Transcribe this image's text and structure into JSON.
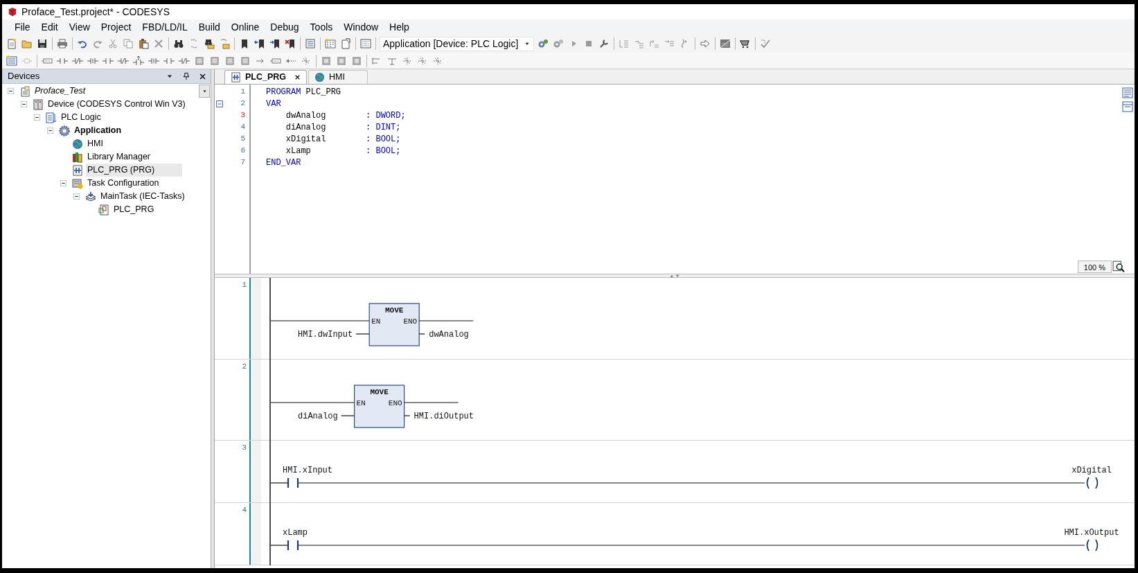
{
  "window": {
    "title": "Proface_Test.project* - CODESYS"
  },
  "menu": [
    "File",
    "Edit",
    "View",
    "Project",
    "FBD/LD/IL",
    "Build",
    "Online",
    "Debug",
    "Tools",
    "Window",
    "Help"
  ],
  "toolbar": {
    "application_selector": "Application [Device: PLC Logic]"
  },
  "devices_panel": {
    "title": "Devices",
    "tree": [
      {
        "label": "Proface_Test",
        "kind": "project",
        "expanded": true,
        "selected": false,
        "children": [
          {
            "label": "Device (CODESYS Control Win V3)",
            "kind": "device",
            "expanded": true,
            "selected": false,
            "children": [
              {
                "label": "PLC Logic",
                "kind": "plc",
                "expanded": true,
                "selected": false,
                "children": [
                  {
                    "label": "Application",
                    "kind": "application",
                    "expanded": true,
                    "selected": false,
                    "children": [
                      {
                        "label": "HMI",
                        "kind": "hmi",
                        "selected": false
                      },
                      {
                        "label": "Library Manager",
                        "kind": "library",
                        "selected": false
                      },
                      {
                        "label": "PLC_PRG (PRG)",
                        "kind": "pou",
                        "selected": true
                      },
                      {
                        "label": "Task Configuration",
                        "kind": "tasks",
                        "expanded": true,
                        "selected": false,
                        "children": [
                          {
                            "label": "MainTask (IEC-Tasks)",
                            "kind": "task",
                            "expanded": true,
                            "selected": false,
                            "children": [
                              {
                                "label": "PLC_PRG",
                                "kind": "call",
                                "selected": false
                              }
                            ]
                          }
                        ]
                      }
                    ]
                  }
                ]
              }
            ]
          }
        ]
      }
    ]
  },
  "editor_tabs": [
    {
      "label": "PLC_PRG",
      "kind": "pou",
      "selected": true
    },
    {
      "label": "HMI",
      "kind": "hmi",
      "selected": false
    }
  ],
  "declaration": {
    "lines": [
      {
        "number": "1",
        "current": false,
        "segments": [
          {
            "text": "PROGRAM",
            "kind": "keyword"
          },
          {
            "text": " PLC_PRG",
            "kind": "plain"
          }
        ]
      },
      {
        "number": "2",
        "current": false,
        "expanded": true,
        "segments": [
          {
            "text": "VAR",
            "kind": "keyword"
          }
        ]
      },
      {
        "number": "3",
        "current": true,
        "segments": [
          {
            "text": "    dwAnalog        ",
            "kind": "plain"
          },
          {
            "text": ": DWORD;",
            "kind": "keyword"
          }
        ]
      },
      {
        "number": "4",
        "current": false,
        "segments": [
          {
            "text": "    diAnalog        ",
            "kind": "plain"
          },
          {
            "text": ": DINT;",
            "kind": "keyword"
          }
        ]
      },
      {
        "number": "5",
        "current": false,
        "segments": [
          {
            "text": "    xDigital        ",
            "kind": "plain"
          },
          {
            "text": ": BOOL;",
            "kind": "keyword"
          }
        ]
      },
      {
        "number": "6",
        "current": false,
        "segments": [
          {
            "text": "    xLamp           ",
            "kind": "plain"
          },
          {
            "text": ": BOOL;",
            "kind": "keyword"
          }
        ]
      },
      {
        "number": "7",
        "current": false,
        "segments": [
          {
            "text": "END_VAR",
            "kind": "keyword"
          }
        ]
      }
    ],
    "zoom": "100 %"
  },
  "networks": [
    {
      "number": "1",
      "kind": "box",
      "function": "MOVE",
      "input_pin": "EN",
      "output_pin": "ENO",
      "input": "HMI.dwInput",
      "output": "dwAnalog"
    },
    {
      "number": "2",
      "kind": "box",
      "function": "MOVE",
      "input_pin": "EN",
      "output_pin": "ENO",
      "input": "diAnalog",
      "output": "HMI.diOutput"
    },
    {
      "number": "3",
      "kind": "contact_coil",
      "contact": "HMI.xInput",
      "coil": "xDigital"
    },
    {
      "number": "4",
      "kind": "contact_coil",
      "contact": "xLamp",
      "coil": "HMI.xOutput"
    }
  ]
}
